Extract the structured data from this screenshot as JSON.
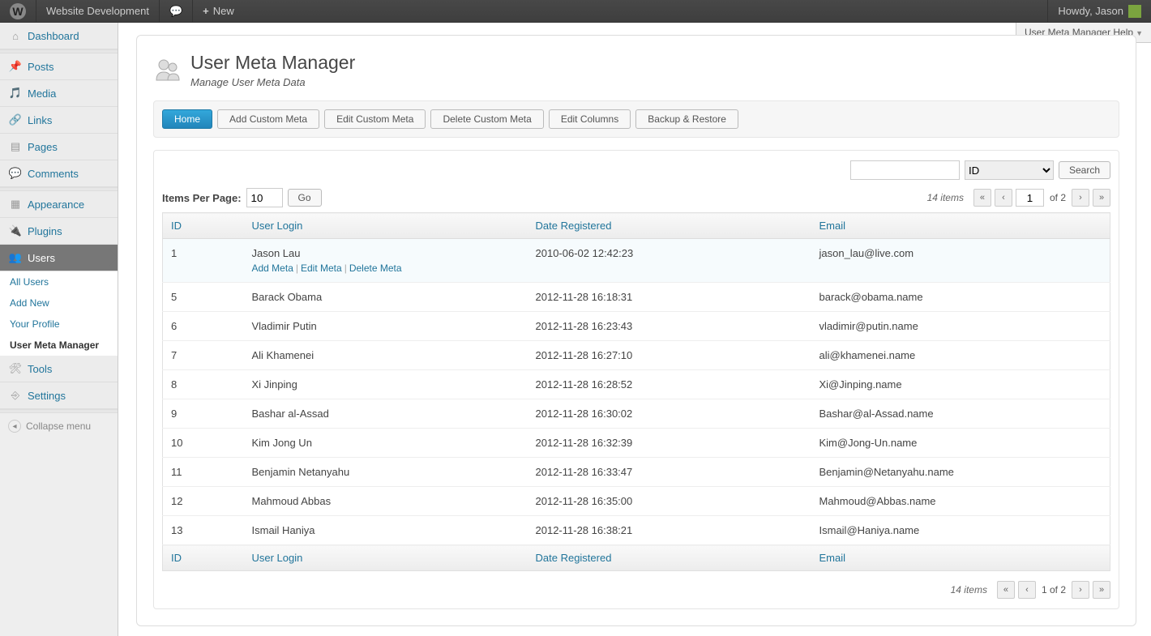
{
  "adminbar": {
    "site": "Website Development",
    "new": "New",
    "howdy": "Howdy, Jason"
  },
  "help_tab": "User Meta Manager Help",
  "sidebar": {
    "dashboard": "Dashboard",
    "posts": "Posts",
    "media": "Media",
    "links": "Links",
    "pages": "Pages",
    "comments": "Comments",
    "appearance": "Appearance",
    "plugins": "Plugins",
    "users": "Users",
    "users_sub": {
      "all": "All Users",
      "add": "Add New",
      "profile": "Your Profile",
      "umm": "User Meta Manager"
    },
    "tools": "Tools",
    "settings": "Settings",
    "collapse": "Collapse menu"
  },
  "page": {
    "title": "User Meta Manager",
    "subtitle": "Manage User Meta Data"
  },
  "tabs": {
    "home": "Home",
    "add": "Add Custom Meta",
    "edit": "Edit Custom Meta",
    "delete": "Delete Custom Meta",
    "columns": "Edit Columns",
    "backup": "Backup & Restore"
  },
  "search": {
    "field": "ID",
    "button": "Search"
  },
  "list": {
    "ipp_label": "Items Per Page:",
    "ipp_value": "10",
    "go": "Go",
    "count": "14 items",
    "page": "1",
    "total_pages": "of 2",
    "page_range": "1 of 2"
  },
  "columns": {
    "id": "ID",
    "login": "User Login",
    "date": "Date Registered",
    "email": "Email"
  },
  "row_actions": {
    "add": "Add Meta",
    "edit": "Edit Meta",
    "delete": "Delete Meta"
  },
  "rows": [
    {
      "id": "1",
      "login": "Jason Lau",
      "date": "2010-06-02 12:42:23",
      "email": "jason_lau@live.com",
      "hovered": true
    },
    {
      "id": "5",
      "login": "Barack Obama",
      "date": "2012-11-28 16:18:31",
      "email": "barack@obama.name"
    },
    {
      "id": "6",
      "login": "Vladimir Putin",
      "date": "2012-11-28 16:23:43",
      "email": "vladimir@putin.name"
    },
    {
      "id": "7",
      "login": "Ali Khamenei",
      "date": "2012-11-28 16:27:10",
      "email": "ali@khamenei.name"
    },
    {
      "id": "8",
      "login": "Xi Jinping",
      "date": "2012-11-28 16:28:52",
      "email": "Xi@Jinping.name"
    },
    {
      "id": "9",
      "login": "Bashar al-Assad",
      "date": "2012-11-28 16:30:02",
      "email": "Bashar@al-Assad.name"
    },
    {
      "id": "10",
      "login": "Kim Jong Un",
      "date": "2012-11-28 16:32:39",
      "email": "Kim@Jong-Un.name"
    },
    {
      "id": "11",
      "login": "Benjamin Netanyahu",
      "date": "2012-11-28 16:33:47",
      "email": "Benjamin@Netanyahu.name"
    },
    {
      "id": "12",
      "login": "Mahmoud Abbas",
      "date": "2012-11-28 16:35:00",
      "email": "Mahmoud@Abbas.name"
    },
    {
      "id": "13",
      "login": "Ismail Haniya",
      "date": "2012-11-28 16:38:21",
      "email": "Ismail@Haniya.name"
    }
  ]
}
